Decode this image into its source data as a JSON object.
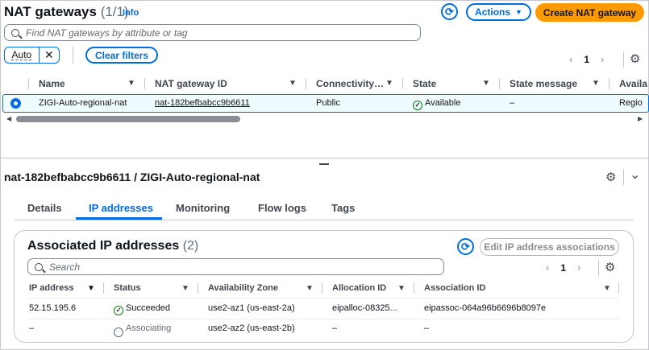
{
  "header": {
    "title": "NAT gateways",
    "count": "(1/1)",
    "info": "Info",
    "actions_label": "Actions",
    "actions_caret": "▼",
    "create_label": "Create NAT gateway",
    "refresh_glyph": "⟳"
  },
  "search": {
    "placeholder": "Find NAT gateways by attribute or tag"
  },
  "filter": {
    "token": "Auto",
    "remove": "✕",
    "clear_label": "Clear filters"
  },
  "pagination": {
    "prev": "‹",
    "page": "1",
    "next": "›",
    "settings_glyph": "⚙"
  },
  "table": {
    "columns": [
      "Name",
      "NAT gateway ID",
      "Connectivity…",
      "State",
      "State message",
      "Availa"
    ],
    "sort_caret": "▼",
    "row": {
      "name": "ZIGI-Auto-regional-nat",
      "id": "nat-182befbabcc9b6611",
      "connectivity": "Public",
      "state": "Available",
      "state_message": "–",
      "availability": "Regio"
    },
    "scroll_left": "◀",
    "scroll_right": "▶"
  },
  "details": {
    "title": "nat-182befbabcc9b6611 / ZIGI-Auto-regional-nat",
    "collapse_glyph": "⌄",
    "tabs": [
      "Details",
      "IP addresses",
      "Monitoring",
      "Flow logs",
      "Tags"
    ],
    "active_tab": "IP addresses"
  },
  "ip_panel": {
    "title": "Associated IP addresses",
    "count": "(2)",
    "edit_label": "Edit IP address associations",
    "search_placeholder": "Search",
    "columns": [
      "IP address",
      "Status",
      "Availability Zone",
      "Allocation ID",
      "Association ID"
    ],
    "rows": [
      {
        "ip": "52.15.195.6",
        "status": "Succeeded",
        "zone": "use2-az1 (us-east-2a)",
        "allocation": "eipalloc-08325...",
        "association": "eipassoc-064a96b6696b8097e"
      },
      {
        "ip": "–",
        "status": "Associating",
        "zone": "use2-az2 (us-east-2b)",
        "allocation": "–",
        "association": "–"
      }
    ]
  },
  "colors": {
    "accent": "#006ce0",
    "primary": "#ff9900",
    "success": "#037f0c"
  }
}
